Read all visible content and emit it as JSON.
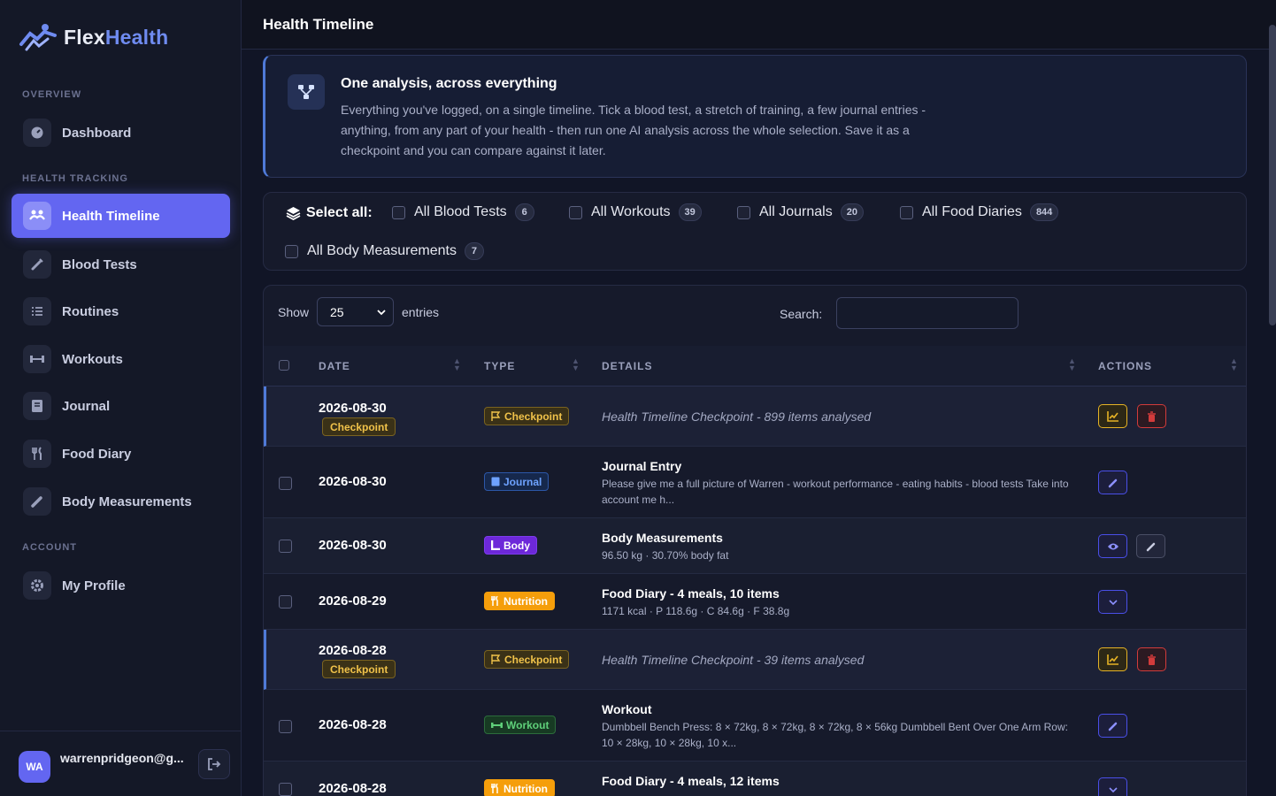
{
  "brand": {
    "name_prefix": "Flex",
    "name_suffix": "Health"
  },
  "sidebar": {
    "sections": {
      "overview": "OVERVIEW",
      "health_tracking": "HEALTH TRACKING",
      "account": "ACCOUNT"
    },
    "items": [
      {
        "label": "Dashboard",
        "icon": "gauge-icon"
      },
      {
        "label": "Health Timeline",
        "icon": "users-icon",
        "active": true
      },
      {
        "label": "Blood Tests",
        "icon": "syringe-icon"
      },
      {
        "label": "Routines",
        "icon": "list-icon"
      },
      {
        "label": "Workouts",
        "icon": "dumbbell-icon"
      },
      {
        "label": "Journal",
        "icon": "book-icon"
      },
      {
        "label": "Food Diary",
        "icon": "utensils-icon"
      },
      {
        "label": "Body Measurements",
        "icon": "pencil-icon"
      },
      {
        "label": "My Profile",
        "icon": "gear-icon"
      }
    ],
    "user": {
      "initials": "WA",
      "email": "warrenpridgeon@g..."
    }
  },
  "header": {
    "title": "Health Timeline"
  },
  "info": {
    "title": "One analysis, across everything",
    "body": "Everything you've logged, on a single timeline. Tick a blood test, a stretch of training, a few journal entries - anything, from any part of your health - then run one AI analysis across the whole selection. Save it as a checkpoint and you can compare against it later."
  },
  "select_all": {
    "label": "Select all:",
    "options": [
      {
        "label": "All Blood Tests",
        "count": "6"
      },
      {
        "label": "All Workouts",
        "count": "39"
      },
      {
        "label": "All Journals",
        "count": "20"
      },
      {
        "label": "All Food Diaries",
        "count": "844"
      },
      {
        "label": "All Body Measurements",
        "count": "7"
      }
    ]
  },
  "table": {
    "show_label": "Show",
    "page_size": "25",
    "entries_label": "entries",
    "search_label": "Search:",
    "columns": {
      "date": "DATE",
      "type": "TYPE",
      "details": "DETAILS",
      "actions": "ACTIONS"
    },
    "rows": [
      {
        "date": "2026-08-30",
        "tag": "Checkpoint",
        "type": "Checkpoint",
        "details": "Health Timeline Checkpoint - 899 items analysed"
      },
      {
        "date": "2026-08-30",
        "type": "Journal",
        "title": "Journal Entry",
        "sub": "Please give me a full picture of Warren - workout performance - eating habits - blood tests Take into account me h..."
      },
      {
        "date": "2026-08-30",
        "type": "Body",
        "title": "Body Measurements",
        "sub": "96.50 kg · 30.70% body fat"
      },
      {
        "date": "2026-08-29",
        "type": "Nutrition",
        "title": "Food Diary - 4 meals, 10 items",
        "sub": "1171 kcal · P 118.6g · C 84.6g · F 38.8g"
      },
      {
        "date": "2026-08-28",
        "tag": "Checkpoint",
        "type": "Checkpoint",
        "details": "Health Timeline Checkpoint - 39 items analysed"
      },
      {
        "date": "2026-08-28",
        "type": "Workout",
        "title": "Workout",
        "sub": "Dumbbell Bench Press: 8 × 72kg, 8 × 72kg, 8 × 72kg, 8 × 56kg Dumbbell Bent Over One Arm Row: 10 × 28kg, 10 × 28kg, 10 x..."
      },
      {
        "date": "2026-08-28",
        "type": "Nutrition",
        "title": "Food Diary - 4 meals, 12 items",
        "sub": ""
      }
    ]
  },
  "colors": {
    "accent": "#6366f1",
    "checkpoint": "#f0c24a",
    "danger": "#d23b3b"
  }
}
